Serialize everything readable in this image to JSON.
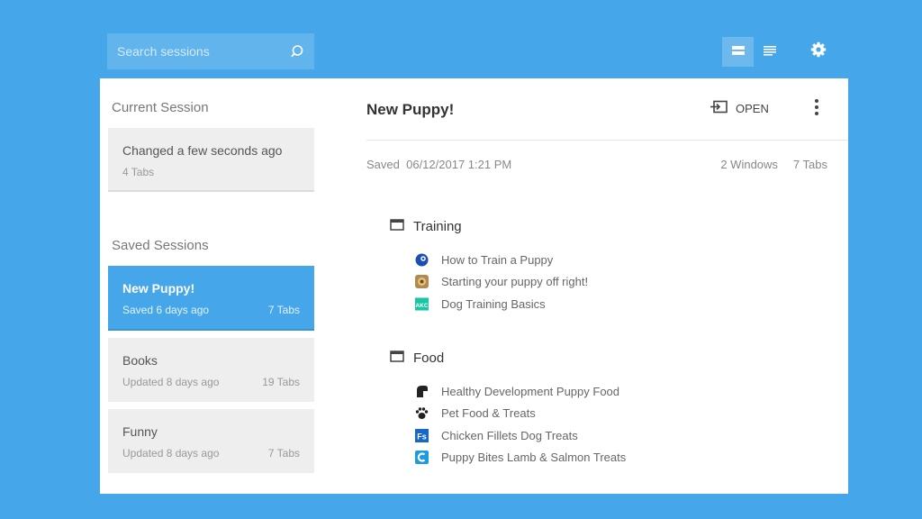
{
  "search": {
    "placeholder": "Search sessions",
    "icon": "search-icon"
  },
  "toolbar": {
    "icons": [
      "list-view-icon",
      "detail-view-icon",
      "gear-icon"
    ]
  },
  "sidebar": {
    "current_title": "Current Session",
    "current": {
      "name": "Changed a few seconds ago",
      "tabs": "4 Tabs"
    },
    "saved_title": "Saved Sessions",
    "saved": [
      {
        "name": "New Puppy!",
        "date": "Saved 6 days ago",
        "tabs": "7 Tabs"
      },
      {
        "name": "Books",
        "date": "Updated 8 days ago",
        "tabs": "19 Tabs"
      },
      {
        "name": "Funny",
        "date": "Updated 8 days ago",
        "tabs": "7 Tabs"
      }
    ]
  },
  "main": {
    "title": "New Puppy!",
    "open_label": "OPEN",
    "saved_label": "Saved",
    "saved_date": "06/12/2017 1:21 PM",
    "windows_count": "2 Windows",
    "tabs_count": "7 Tabs",
    "windows": [
      {
        "name": "Training",
        "tabs": [
          {
            "title": "How to Train a Puppy",
            "icon": "site-globe-icon"
          },
          {
            "title": "Starting your puppy off right!",
            "icon": "site-puppy-icon"
          },
          {
            "title": "Dog Training Basics",
            "icon": "akc-icon"
          }
        ]
      },
      {
        "name": "Food",
        "tabs": [
          {
            "title": "Healthy Development Puppy Food",
            "icon": "dog-head-icon"
          },
          {
            "title": "Pet Food & Treats",
            "icon": "paw-icon"
          },
          {
            "title": "Chicken Fillets Dog Treats",
            "icon": "fs-icon"
          },
          {
            "title": "Puppy Bites Lamb & Salmon Treats",
            "icon": "c-logo-icon"
          }
        ]
      }
    ]
  },
  "colors": {
    "accent": "#45a6ea",
    "card": "#eeeeee"
  },
  "favicon_text": {
    "akc": "AKC",
    "fs": "Fs"
  }
}
